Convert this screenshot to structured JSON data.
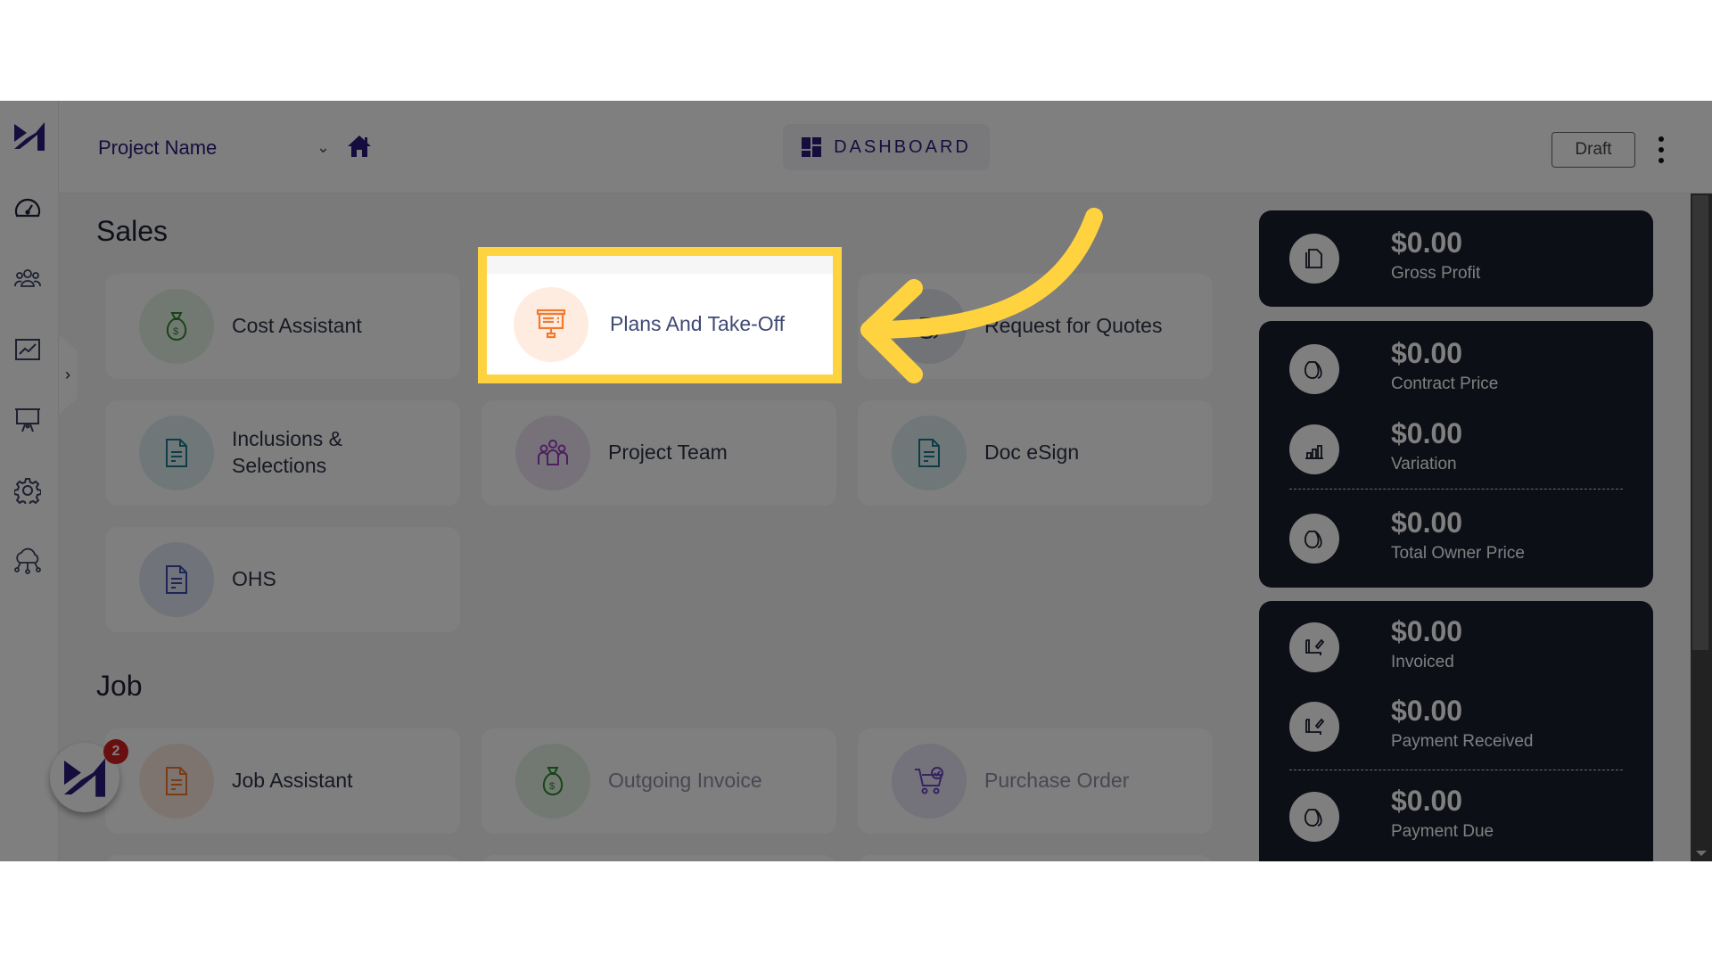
{
  "header": {
    "project_select": "Project Name",
    "dashboard_tab": "DASHBOARD",
    "status_button": "Draft"
  },
  "sidebar": {
    "items": [
      {
        "icon": "speedometer-icon",
        "label": "Dashboard"
      },
      {
        "icon": "users-icon",
        "label": "Contacts"
      },
      {
        "icon": "chart-line-icon",
        "label": "Reports"
      },
      {
        "icon": "presentation-icon",
        "label": "Plans"
      },
      {
        "icon": "gear-icon",
        "label": "Settings"
      },
      {
        "icon": "cloud-network-icon",
        "label": "Integrations"
      }
    ]
  },
  "sections": {
    "sales": {
      "title": "Sales",
      "cards": [
        {
          "label": "Cost Assistant",
          "icon": "money-bag-icon",
          "color": "#2e8b2e"
        },
        {
          "label": "Plans And Take-Off",
          "icon": "presentation-board-icon",
          "color": "#f07a2e"
        },
        {
          "label": "Request for Quotes",
          "icon": "money-bags-icon",
          "color": "#333a4e"
        },
        {
          "label": "Inclusions & Selections",
          "icon": "document-icon",
          "color": "#1d7a8a"
        },
        {
          "label": "Project Team",
          "icon": "team-icon",
          "color": "#9a3fc0"
        },
        {
          "label": "Doc eSign",
          "icon": "document-icon",
          "color": "#1d7a8a"
        },
        {
          "label": "OHS",
          "icon": "document-icon",
          "color": "#3a4bb0"
        }
      ]
    },
    "job": {
      "title": "Job",
      "cards": [
        {
          "label": "Job Assistant",
          "icon": "document-icon",
          "color": "#f07a2e"
        },
        {
          "label": "Outgoing Invoice",
          "icon": "money-bag-icon",
          "color": "#2e8b2e"
        },
        {
          "label": "Purchase Order",
          "icon": "cart-check-icon",
          "color": "#6a4bc0"
        }
      ]
    }
  },
  "summary": {
    "gross_profit": {
      "value": "$0.00",
      "label": "Gross Profit"
    },
    "contract_price": {
      "value": "$0.00",
      "label": "Contract Price"
    },
    "variation": {
      "value": "$0.00",
      "label": "Variation"
    },
    "total_owner_price": {
      "value": "$0.00",
      "label": "Total Owner Price"
    },
    "invoiced": {
      "value": "$0.00",
      "label": "Invoiced"
    },
    "payment_received": {
      "value": "$0.00",
      "label": "Payment Received"
    },
    "payment_due": {
      "value": "$0.00",
      "label": "Payment Due"
    }
  },
  "fab": {
    "badge_count": "2"
  },
  "annotation": {
    "highlight_color": "#ffd23f",
    "target": "Plans And Take-Off"
  }
}
